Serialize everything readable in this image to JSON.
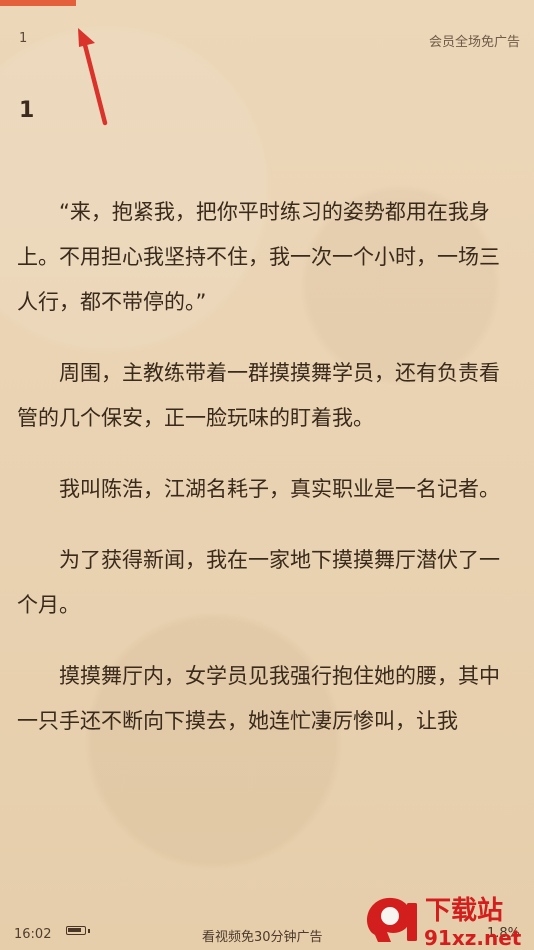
{
  "header": {
    "page_number": "1",
    "vip_text": "会员全场免广告"
  },
  "chapter": {
    "title": "1"
  },
  "paragraphs": [
    "“来，抱紧我，把你平时练习的姿势都用在我身上。不用担心我坚持不住，我一次一个小时，一场三人行，都不带停的。”",
    "周围，主教练带着一群摸摸舞学员，还有负责看管的几个保安，正一脸玩味的盯着我。",
    "我叫陈浩，江湖名耗子，真实职业是一名记者。",
    "为了获得新闻，我在一家地下摸摸舞厅潜伏了一个月。",
    "摸摸舞厅内，女学员见我强行抱住她的腰，其中一只手还不断向下摸去，她连忙凄厉惨叫，让我"
  ],
  "footer": {
    "time": "16:02",
    "ad_text": "看视频免30分钟广告",
    "progress_percent": "1.8%"
  },
  "watermark": {
    "main": "下载站",
    "domain": "91xz.net"
  },
  "colors": {
    "accent": "#e45f3c",
    "arrow": "#d9332b",
    "text": "#3a2a1c"
  },
  "icons": {
    "arrow": "arrow-icon",
    "battery": "battery-icon",
    "logo": "logo-icon"
  },
  "battery_level": 0.8
}
